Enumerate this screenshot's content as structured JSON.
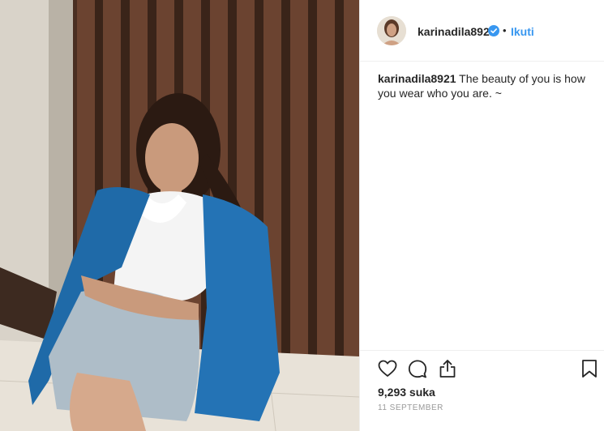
{
  "post": {
    "username": "karinadila8921",
    "verified": true,
    "follow_label": "Ikuti",
    "separator": "•",
    "caption_text": "The beauty of you is how you wear who you are. ~",
    "likes_label": "9,293 suka",
    "date_label": "11 SEPTEMBER"
  },
  "icons": {
    "like": "heart-icon",
    "comment": "comment-icon",
    "share": "share-icon",
    "save": "bookmark-icon",
    "verified": "verified-badge-icon"
  },
  "colors": {
    "link": "#3897f0",
    "verified": "#3897f0",
    "text": "#262626",
    "muted": "#999999",
    "divider": "#efefef"
  }
}
